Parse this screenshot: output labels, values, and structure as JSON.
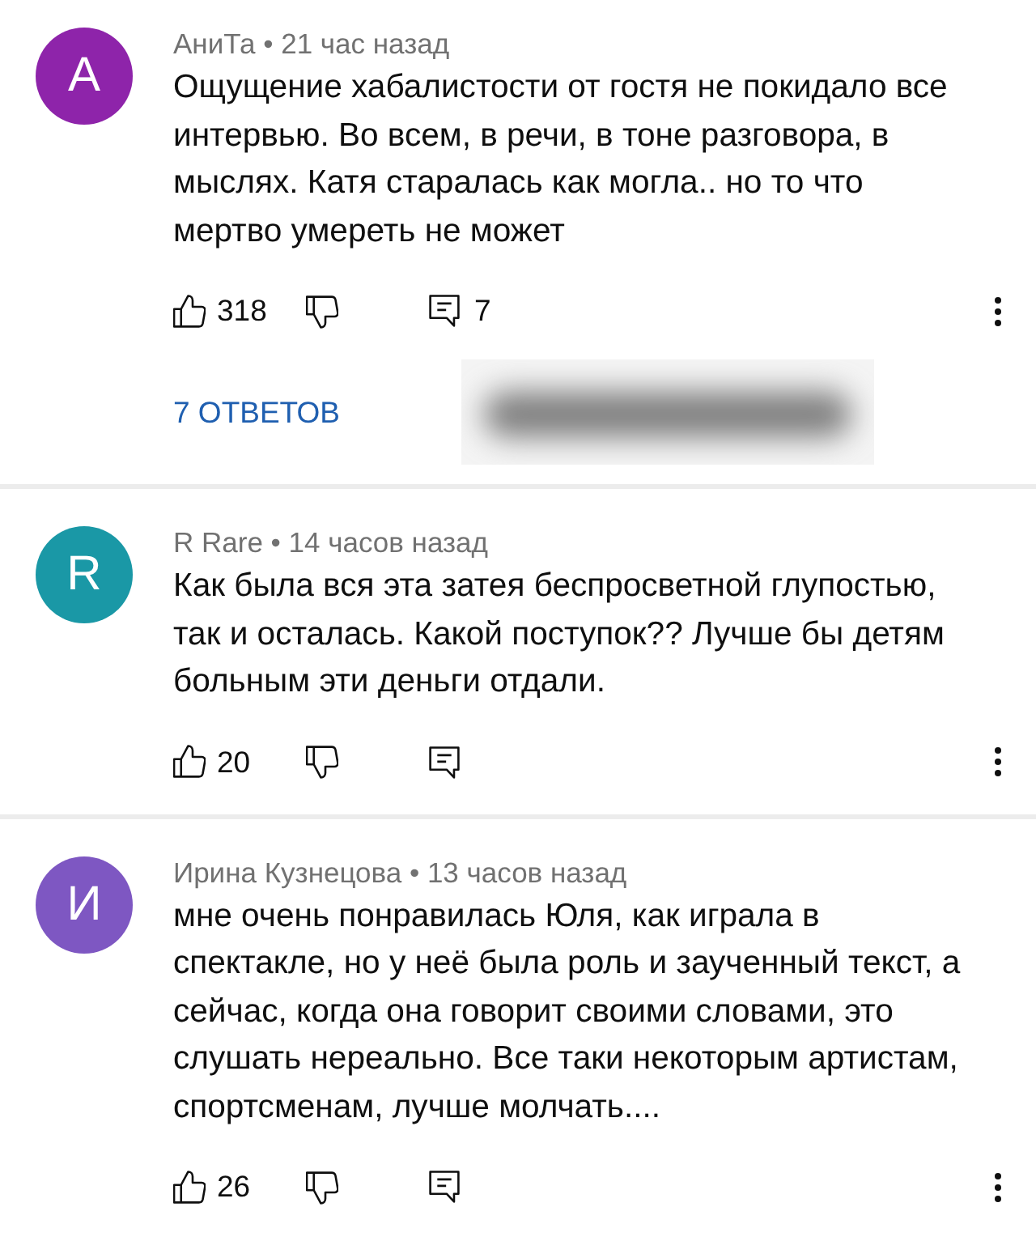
{
  "comments": [
    {
      "avatar": {
        "letter": "А",
        "color": "#8e24aa"
      },
      "meta": "АниТа • 21 час назад",
      "text": "Ощущение хабалистости от гостя не покидало все интервью. Во всем, в речи, в тоне разговора, в мыслях. Катя старалась как могла.. но то что мертво умереть не может",
      "likes": "318",
      "reply_count": "7",
      "replies_link": "7 ОТВЕТОВ",
      "blurred_area": true
    },
    {
      "avatar": {
        "letter": "R",
        "color": "#1a98a6"
      },
      "meta": "R Rare • 14 часов назад",
      "text": "Как была вся эта затея беспросветной глупостью, так и осталась. Какой поступок?? Лучше бы детям больным эти деньги отдали.",
      "likes": "20"
    },
    {
      "avatar": {
        "letter": "И",
        "color": "#7e57c2"
      },
      "meta": "Ирина Кузнецова • 13 часов назад",
      "text": "мне очень понравилась Юля, как играла в спектакле, но у неё была роль и заученный текст, а сейчас, когда она говорит своими словами, это слушать нереально. Все таки некоторым артистам, спортсменам, лучше молчать....",
      "likes": "26"
    }
  ]
}
